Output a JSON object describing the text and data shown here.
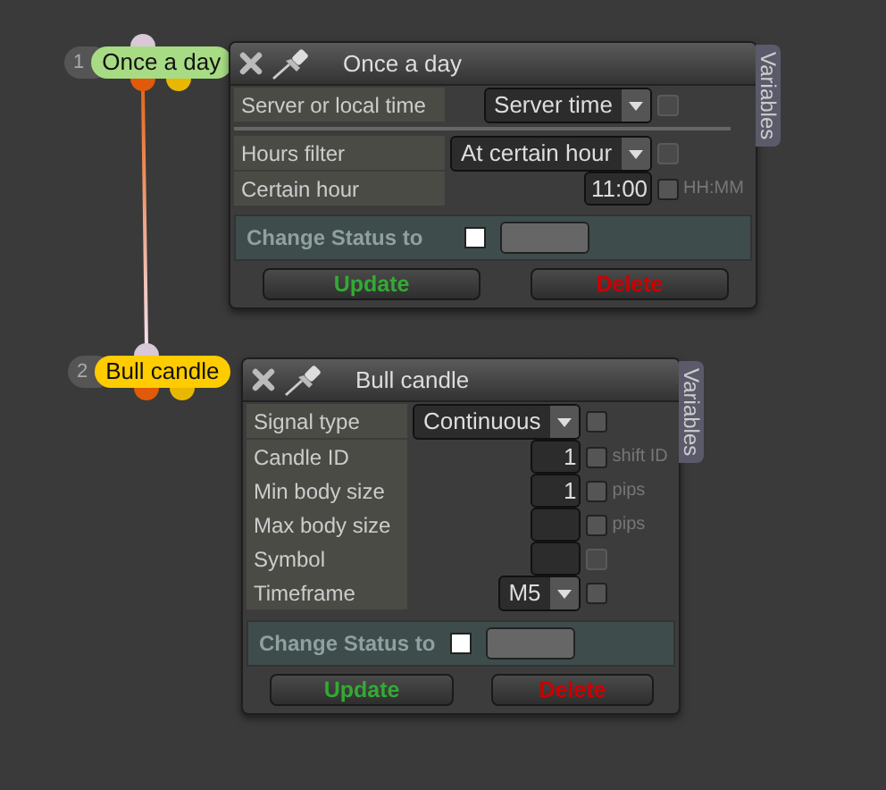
{
  "nodes": [
    {
      "number": "1",
      "label": "Once a day",
      "color": "#a8dc84",
      "panel": {
        "title": "Once a day",
        "tab": "Variables",
        "groups": [
          [
            {
              "label": "Server or local time",
              "kind": "select",
              "value": "Server time",
              "checkbox_disabled": true
            }
          ],
          [
            {
              "label": "Hours filter",
              "kind": "select",
              "value": "At certain hour",
              "checkbox_disabled": true
            },
            {
              "label": "Certain hour",
              "kind": "input",
              "value": "11:00",
              "checkbox_disabled": false,
              "unit": "HH:MM"
            }
          ]
        ],
        "status": {
          "label": "Change Status to",
          "checked": false
        },
        "buttons": [
          {
            "label": "Update",
            "kind": "update"
          },
          {
            "label": "Delete",
            "kind": "delete"
          }
        ]
      }
    },
    {
      "number": "2",
      "label": "Bull candle",
      "color": "#ffcc00",
      "panel": {
        "title": "Bull candle",
        "tab": "Variables",
        "groups": [
          [
            {
              "label": "Signal type",
              "kind": "select",
              "value": "Continuous",
              "checkbox_disabled": false
            },
            {
              "label": "Candle ID",
              "kind": "input",
              "value": "1",
              "checkbox_disabled": false,
              "unit": "shift ID"
            },
            {
              "label": "Min body size",
              "kind": "input",
              "value": "1",
              "checkbox_disabled": false,
              "unit": "pips"
            },
            {
              "label": "Max body size",
              "kind": "input",
              "checkbox_disabled": false,
              "unit": "pips"
            },
            {
              "label": "Symbol",
              "kind": "input",
              "checkbox_disabled": true
            },
            {
              "label": "Timeframe",
              "kind": "select",
              "value": "M5",
              "checkbox_disabled": false
            }
          ]
        ],
        "status": {
          "label": "Change Status to",
          "checked": false
        },
        "buttons": [
          {
            "label": "Update",
            "kind": "update"
          },
          {
            "label": "Delete",
            "kind": "delete"
          }
        ]
      }
    }
  ]
}
